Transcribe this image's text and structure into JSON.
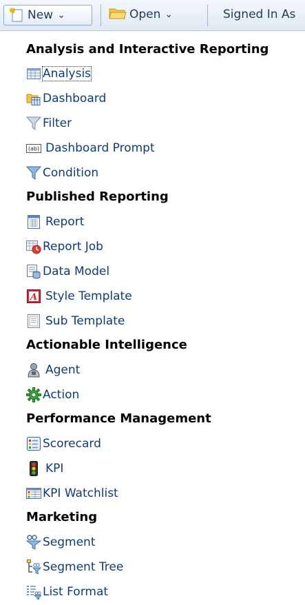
{
  "toolbar": {
    "new_label": "New",
    "new_icon": "new-page-icon",
    "open_label": "Open",
    "open_icon": "folder-icon",
    "signed_label": "Signed In As",
    "chevron": "⌄"
  },
  "sections": {
    "analysis": {
      "title": "Analysis and Interactive Reporting",
      "items": [
        "Analysis",
        "Dashboard",
        "Filter",
        "Dashboard Prompt",
        "Condition"
      ]
    },
    "published": {
      "title": "Published Reporting",
      "items": [
        "Report",
        "Report Job",
        "Data Model",
        "Style Template",
        "Sub Template"
      ]
    },
    "actionable": {
      "title": "Actionable Intelligence",
      "items": [
        "Agent",
        "Action"
      ]
    },
    "performance": {
      "title": "Performance Management",
      "items": [
        "Scorecard",
        "KPI",
        "KPI Watchlist"
      ]
    },
    "marketing": {
      "title": "Marketing",
      "items": [
        "Segment",
        "Segment Tree",
        "List Format"
      ]
    }
  },
  "icons": {
    "analysis": "analysis-grid-icon",
    "dashboard": "dashboard-folder-icon",
    "filter": "filter-funnel-icon",
    "prompt": "prompt-ab-icon",
    "condition": "condition-funnel-icon",
    "report": "report-grid-icon",
    "report_job": "report-job-clock-icon",
    "data_model": "data-model-icon",
    "style_template": "style-template-icon",
    "sub_template": "sub-template-icon",
    "agent": "agent-icon",
    "action": "action-gear-icon",
    "scorecard": "scorecard-icon",
    "kpi": "kpi-traffic-light-icon",
    "kpi_watchlist": "kpi-watchlist-icon",
    "segment": "segment-icon",
    "segment_tree": "segment-tree-icon",
    "list_format": "list-format-icon"
  },
  "colors": {
    "link": "#0e3c7a",
    "toolbar_bg": "#e6eef7",
    "filter": "#5b8fd1",
    "style_red": "#d8252b"
  }
}
